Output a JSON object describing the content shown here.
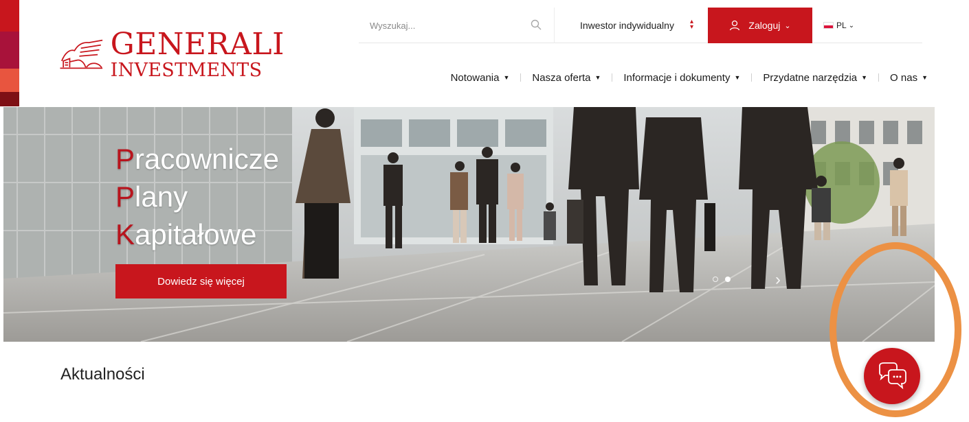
{
  "brand": {
    "name_line1": "GENERALI",
    "name_line2": "INVESTMENTS",
    "accent_color": "#c8161d"
  },
  "utility_bar": {
    "search": {
      "placeholder": "Wyszukaj...",
      "value": "",
      "icon": "search-icon"
    },
    "investor_select": {
      "selected": "Inwestor indywidualny"
    },
    "login": {
      "label": "Zaloguj",
      "icon": "user-icon"
    },
    "language": {
      "code": "PL",
      "flag": "poland-flag"
    }
  },
  "main_nav": {
    "items": [
      {
        "label": "Notowania"
      },
      {
        "label": "Nasza oferta"
      },
      {
        "label": "Informacje i dokumenty"
      },
      {
        "label": "Przydatne narzędzia"
      },
      {
        "label": "O nas"
      }
    ]
  },
  "hero": {
    "title_lines": [
      {
        "first": "P",
        "rest": "racownicze"
      },
      {
        "first": "P",
        "rest": "lany"
      },
      {
        "first": "K",
        "rest": "apitałowe"
      }
    ],
    "cta_label": "Dowiedz się więcej",
    "slides_total": 2,
    "active_slide": 2
  },
  "news": {
    "heading": "Aktualności"
  },
  "chat": {
    "icon": "chat-bubbles-icon"
  },
  "annotation": {
    "color": "#ec9144"
  }
}
